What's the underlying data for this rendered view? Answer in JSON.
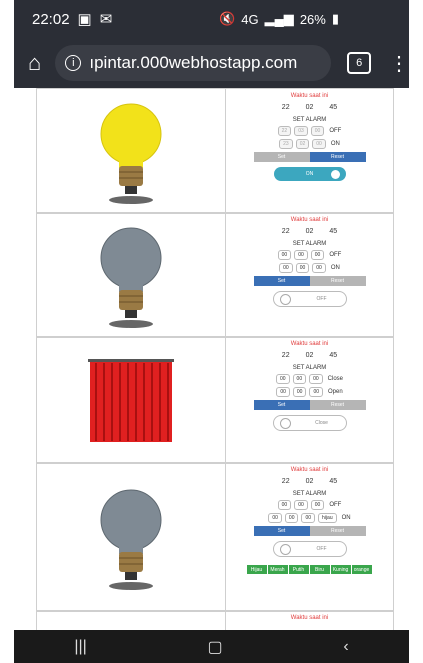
{
  "status": {
    "time": "22:02",
    "signal": "4G",
    "battery": "26%"
  },
  "browser": {
    "url": "ıpintar.000webhostapp.com",
    "tab_count": "6"
  },
  "rows": [
    {
      "waktu": "Waktu saat ini",
      "clock": [
        "22",
        "02",
        "45"
      ],
      "set_alarm": "SET ALARM",
      "off_sel": [
        "22",
        "03",
        "00"
      ],
      "off_state": "OFF",
      "on_sel": [
        "23",
        "02",
        "00"
      ],
      "on_state": "ON",
      "btn_left": "Set",
      "btn_right": "Reset",
      "toggle": "ON"
    },
    {
      "waktu": "Waktu saat ini",
      "clock": [
        "22",
        "02",
        "45"
      ],
      "set_alarm": "SET ALARM",
      "off_sel": [
        "00",
        "00",
        "00"
      ],
      "off_state": "OFF",
      "on_sel": [
        "00",
        "00",
        "00"
      ],
      "on_state": "ON",
      "btn_left": "Set",
      "btn_right": "Reset",
      "toggle": "OFF"
    },
    {
      "waktu": "Waktu saat ini",
      "clock": [
        "22",
        "02",
        "45"
      ],
      "set_alarm": "SET ALARM",
      "off_sel": [
        "00",
        "00",
        "00"
      ],
      "off_state": "Close",
      "on_sel": [
        "00",
        "00",
        "00"
      ],
      "on_state": "Open",
      "btn_left": "Set",
      "btn_right": "Reset",
      "toggle": "Close"
    },
    {
      "waktu": "Waktu saat ini",
      "clock": [
        "22",
        "02",
        "45"
      ],
      "set_alarm": "SET ALARM",
      "off_sel": [
        "00",
        "00",
        "00"
      ],
      "off_state": "OFF",
      "on_sel": [
        "00",
        "00",
        "00"
      ],
      "on_extra": "hijau",
      "on_state": "ON",
      "btn_left": "Set",
      "btn_right": "Reset",
      "toggle": "OFF",
      "colors": [
        "Hijau",
        "Merah",
        "Putih",
        "Biru",
        "Kuning",
        "orange"
      ]
    }
  ],
  "bottom_waktu": "Waktu saat ini"
}
